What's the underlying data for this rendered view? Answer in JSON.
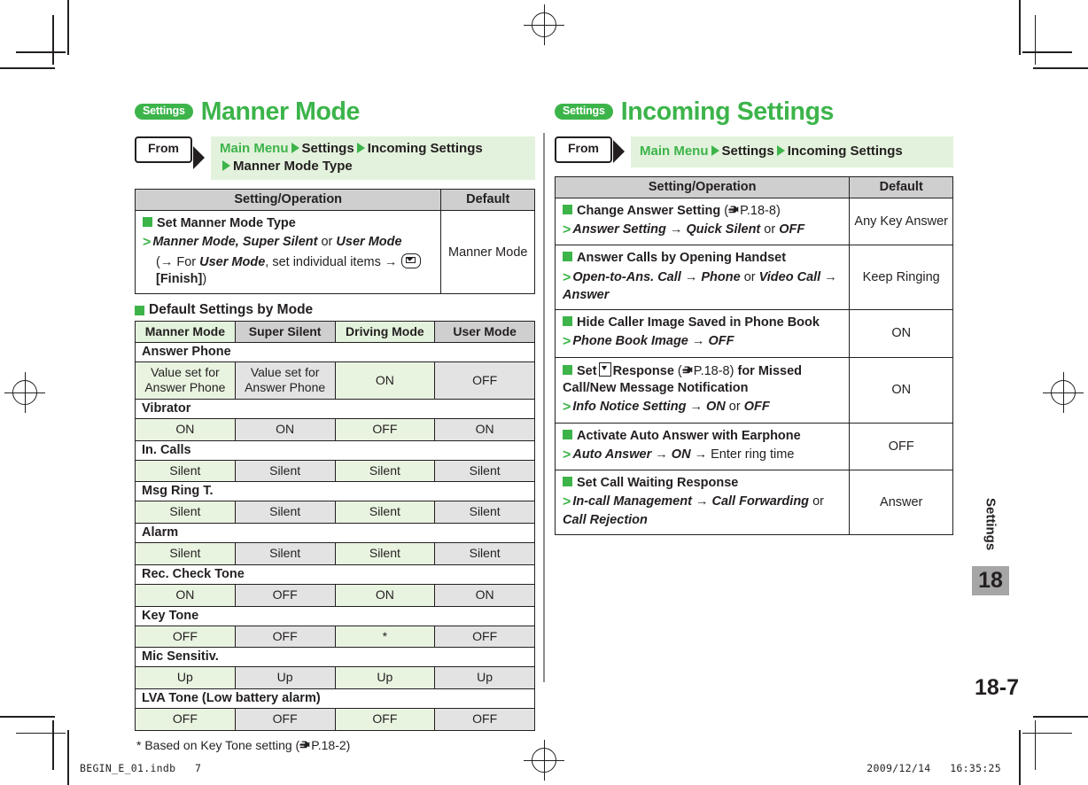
{
  "colors": {
    "brand_green": "#3cb44a",
    "band_green": "#e3f2dc",
    "cell_green": "#e8f4e0",
    "header_grey": "#cfcfcf",
    "cell_grey": "#e3e3e3",
    "tab_grey": "#a6a6a6",
    "ink": "#231f20"
  },
  "left": {
    "badge": "Settings",
    "title": "Manner Mode",
    "from_label": "From",
    "crumbs_line1": [
      "Main Menu",
      "Settings",
      "Incoming Settings"
    ],
    "crumbs_line2": [
      "Manner Mode Type"
    ],
    "table": {
      "headers": [
        "Setting/Operation",
        "Default"
      ],
      "rows": [
        {
          "heading": "Set Manner Mode Type",
          "op_lead": "Manner Mode, Super Silent",
          "op_or": "or",
          "op_tail": "User Mode",
          "op_paren_open": "(→ For",
          "op_paren_italic": "User Mode",
          "op_paren_mid": ", set individual items →",
          "op_key_icon": "envelope-key-icon",
          "op_paren_finish": "[Finish]",
          "op_paren_close": ")",
          "default": "Manner Mode"
        }
      ]
    },
    "subheading": "Default Settings by Mode",
    "mode_table": {
      "columns": [
        "Manner Mode",
        "Super Silent",
        "Driving Mode",
        "User Mode"
      ],
      "groups": [
        {
          "name": "Answer Phone",
          "values": [
            "Value set for Answer Phone",
            "Value set for Answer Phone",
            "ON",
            "OFF"
          ]
        },
        {
          "name": "Vibrator",
          "values": [
            "ON",
            "ON",
            "OFF",
            "ON"
          ]
        },
        {
          "name": "In. Calls",
          "values": [
            "Silent",
            "Silent",
            "Silent",
            "Silent"
          ]
        },
        {
          "name": "Msg Ring T.",
          "values": [
            "Silent",
            "Silent",
            "Silent",
            "Silent"
          ]
        },
        {
          "name": "Alarm",
          "values": [
            "Silent",
            "Silent",
            "Silent",
            "Silent"
          ]
        },
        {
          "name": "Rec. Check Tone",
          "values": [
            "ON",
            "OFF",
            "ON",
            "ON"
          ]
        },
        {
          "name": "Key Tone",
          "values": [
            "OFF",
            "OFF",
            "*",
            "OFF"
          ]
        },
        {
          "name": "Mic Sensitiv.",
          "values": [
            "Up",
            "Up",
            "Up",
            "Up"
          ]
        },
        {
          "name": "LVA Tone (Low battery alarm)",
          "values": [
            "OFF",
            "OFF",
            "OFF",
            "OFF"
          ]
        }
      ]
    },
    "footnote_star": "*",
    "footnote_text": "Based on Key Tone setting (",
    "footnote_ref": "P.18-2",
    "footnote_close": ")"
  },
  "right": {
    "badge": "Settings",
    "title": "Incoming Settings",
    "from_label": "From",
    "crumbs_line1": [
      "Main Menu",
      "Settings",
      "Incoming Settings"
    ],
    "table": {
      "headers": [
        "Setting/Operation",
        "Default"
      ],
      "rows": [
        {
          "heading_a": "Change Answer Setting",
          "heading_ref_open": "(",
          "heading_ref": "P.18-8",
          "heading_ref_close": ")",
          "op_italic_1": "Answer Setting",
          "op_arrow_1": "→",
          "op_italic_2": "Quick Silent",
          "op_or": "or",
          "op_italic_3": "OFF",
          "default": "Any Key Answer"
        },
        {
          "heading_a": "Answer Calls by Opening Handset",
          "op_italic_1": "Open-to-Ans. Call",
          "op_arrow_1": "→",
          "op_italic_2": "Phone",
          "op_or": "or",
          "op_italic_3": "Video Call",
          "op_arrow_2": "→",
          "op_italic_4": "Answer",
          "default": "Keep Ringing"
        },
        {
          "heading_a": "Hide Caller Image Saved in Phone Book",
          "op_italic_1": "Phone Book Image",
          "op_arrow_1": "→",
          "op_italic_2": "OFF",
          "default": "ON"
        },
        {
          "heading_a": "Set",
          "heading_key_icon": "down-key-icon",
          "heading_b": "Response",
          "heading_ref_open": "(",
          "heading_ref": "P.18-8",
          "heading_ref_close": ")",
          "heading_c": "for Missed Call/New Message Notification",
          "op_italic_1": "Info Notice Setting",
          "op_arrow_1": "→",
          "op_italic_2": "ON",
          "op_or": "or",
          "op_italic_3": "OFF",
          "default": "ON"
        },
        {
          "heading_a": "Activate Auto Answer with Earphone",
          "op_italic_1": "Auto Answer",
          "op_arrow_1": "→",
          "op_italic_2": "ON",
          "op_arrow_2": "→",
          "op_plain": "Enter ring time",
          "default": "OFF"
        },
        {
          "heading_a": "Set Call Waiting Response",
          "op_italic_1": "In-call Management",
          "op_arrow_1": "→",
          "op_italic_2": "Call Forwarding",
          "op_or": "or",
          "op_italic_3": "Call Rejection",
          "default": "Answer"
        }
      ]
    }
  },
  "rail": {
    "chapter_label": "Settings",
    "chapter_number": "18"
  },
  "page_number": "18-7",
  "footer": {
    "left": "BEGIN_E_01.indb   7",
    "right": "2009/12/14   16:35:25"
  }
}
